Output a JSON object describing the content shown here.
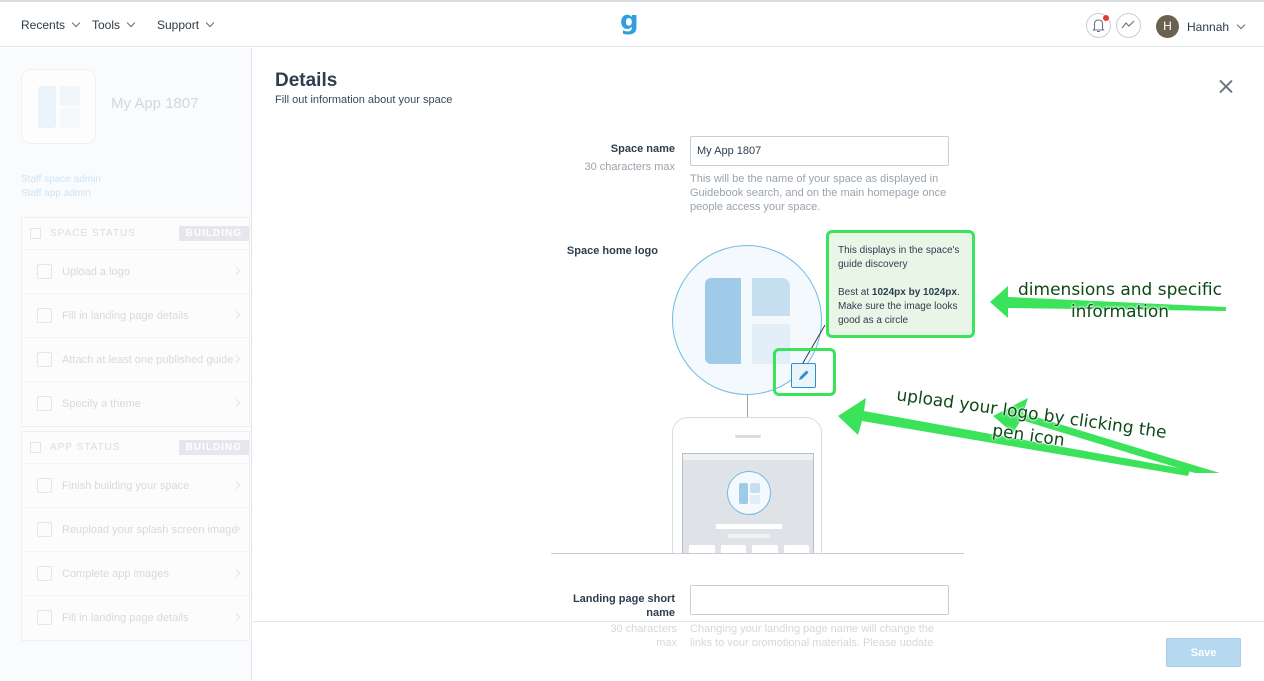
{
  "nav": {
    "recents": "Recents",
    "tools": "Tools",
    "support": "Support",
    "logo": "g",
    "user": "Hannah",
    "avatar_initial": "H"
  },
  "sidebar": {
    "app_name": "My App 1807",
    "links": [
      "Staff space admin",
      "Staff app admin"
    ],
    "space_status": {
      "title": "SPACE STATUS",
      "badge": "BUILDING",
      "items": [
        "Upload a logo",
        "Fill in landing page details",
        "Attach at least one published guide",
        "Specify a theme"
      ]
    },
    "app_status": {
      "title": "APP STATUS",
      "badge": "BUILDING",
      "items": [
        "Finish building your space",
        "Reupload your splash screen image",
        "Complete app images",
        "Fill in landing page details"
      ]
    }
  },
  "details": {
    "title": "Details",
    "subtitle": "Fill out information about your space",
    "space_name_label": "Space name",
    "space_name_hint": "30 characters max",
    "space_name_value": "My App 1807",
    "space_name_help": "This will be the name of your space as displayed in Guidebook search, and on the main homepage once people access your space.",
    "logo_label": "Space home logo",
    "logo_note_line1": "This displays in the space's guide discovery",
    "logo_note_best_prefix": "Best at ",
    "logo_note_best_dims": "1024px by 1024px",
    "logo_note_best_suffix": ". Make sure the image looks good as a circle",
    "landing_label": "Landing page short name",
    "landing_hint": "30 characters max",
    "landing_value": "",
    "landing_help": "Changing your landing page name will change the links to your promotional materials. Please update this"
  },
  "annotations": {
    "dims": "dimensions and specific information",
    "upload": "upload your logo by clicking the pen icon"
  },
  "footer": {
    "save_label": "Save"
  },
  "colors": {
    "annotation_green": "#3be35b",
    "brand_blue": "#2e9fe0"
  }
}
